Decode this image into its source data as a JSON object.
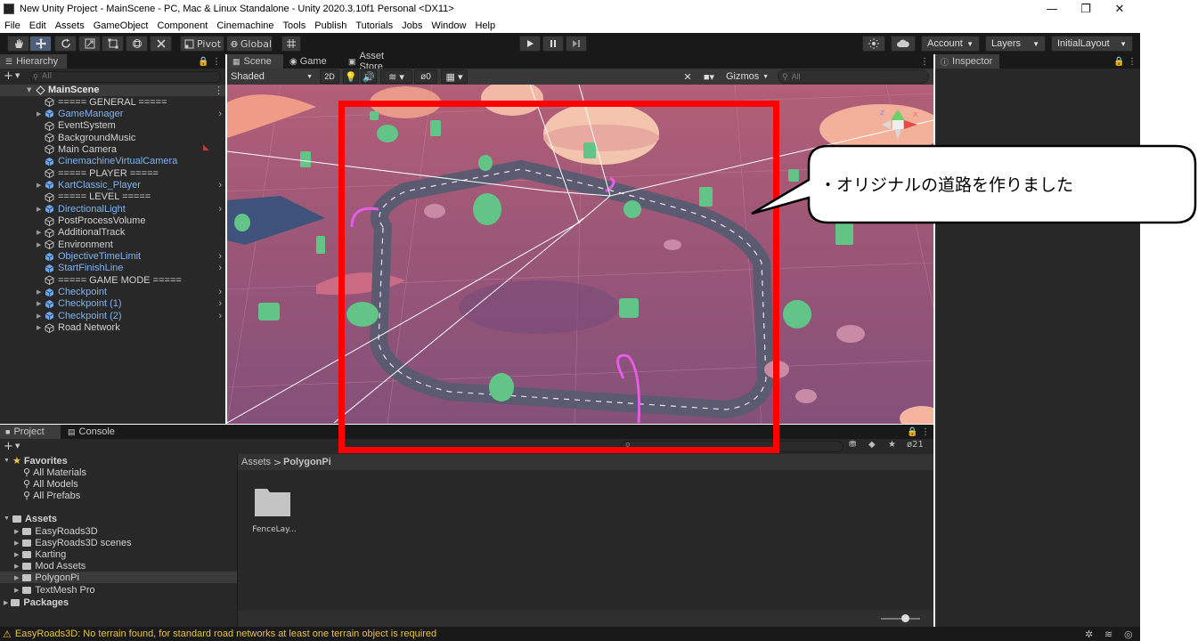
{
  "window": {
    "title": "New Unity Project - MainScene - PC, Mac & Linux Standalone - Unity 2020.3.10f1 Personal <DX11>",
    "controls": [
      "—",
      "❐",
      "✕"
    ]
  },
  "menu": [
    "File",
    "Edit",
    "Assets",
    "GameObject",
    "Component",
    "Cinemachine",
    "Tools",
    "Publish",
    "Tutorials",
    "Jobs",
    "Window",
    "Help"
  ],
  "toolbar": {
    "pivot": "Pivot",
    "global": "Global",
    "account": "Account",
    "layers": "Layers",
    "layout": "InitialLayout"
  },
  "hierarchy": {
    "tab": "Hierarchy",
    "search_placeholder": "All",
    "scene": "MainScene",
    "items": [
      {
        "label": "===== GENERAL =====",
        "blue": false,
        "arrow": false,
        "chev": false
      },
      {
        "label": "GameManager",
        "blue": true,
        "arrow": true,
        "chev": true
      },
      {
        "label": "EventSystem",
        "blue": false,
        "arrow": false,
        "chev": false
      },
      {
        "label": "BackgroundMusic",
        "blue": false,
        "arrow": false,
        "chev": false
      },
      {
        "label": "Main Camera",
        "blue": false,
        "arrow": false,
        "chev": false
      },
      {
        "label": "CinemachineVirtualCamera",
        "blue": true,
        "arrow": false,
        "chev": false
      },
      {
        "label": "===== PLAYER =====",
        "blue": false,
        "arrow": false,
        "chev": false
      },
      {
        "label": "KartClassic_Player",
        "blue": true,
        "arrow": true,
        "chev": true
      },
      {
        "label": "===== LEVEL =====",
        "blue": false,
        "arrow": false,
        "chev": false
      },
      {
        "label": "DirectionalLight",
        "blue": true,
        "arrow": true,
        "chev": true
      },
      {
        "label": "PostProcessVolume",
        "blue": false,
        "arrow": false,
        "chev": false
      },
      {
        "label": "AdditionalTrack",
        "blue": false,
        "arrow": true,
        "chev": false
      },
      {
        "label": "Environment",
        "blue": false,
        "arrow": true,
        "chev": false
      },
      {
        "label": "ObjectiveTimeLimit",
        "blue": true,
        "arrow": false,
        "chev": true
      },
      {
        "label": "StartFinishLine",
        "blue": true,
        "arrow": false,
        "chev": true
      },
      {
        "label": "===== GAME MODE =====",
        "blue": false,
        "arrow": false,
        "chev": false
      },
      {
        "label": "Checkpoint",
        "blue": true,
        "arrow": true,
        "chev": true
      },
      {
        "label": "Checkpoint (1)",
        "blue": true,
        "arrow": true,
        "chev": true
      },
      {
        "label": "Checkpoint (2)",
        "blue": true,
        "arrow": true,
        "chev": true
      },
      {
        "label": "Road Network",
        "blue": false,
        "arrow": true,
        "chev": false
      }
    ]
  },
  "scene_view": {
    "tabs": [
      "Scene",
      "Game",
      "Asset Store"
    ],
    "shading": "Shaded",
    "mode_2d": "2D",
    "hidden_count": "0",
    "gizmos": "Gizmos",
    "search_placeholder": "All",
    "gizmo_axes": {
      "x": "x",
      "z": "z"
    }
  },
  "inspector": {
    "tab": "Inspector"
  },
  "project": {
    "tabs": [
      "Project",
      "Console"
    ],
    "favorites_label": "Favorites",
    "favorites": [
      "All Materials",
      "All Models",
      "All Prefabs"
    ],
    "assets_label": "Assets",
    "assets": [
      "EasyRoads3D",
      "EasyRoads3D scenes",
      "Karting",
      "Mod Assets",
      "PolygonPi",
      "TextMesh Pro"
    ],
    "packages_label": "Packages",
    "breadcrumb": [
      "Assets",
      "PolygonPi"
    ],
    "file_label": "FenceLay...",
    "hidden_count": "21"
  },
  "status": {
    "message": "EasyRoads3D: No terrain found, for standard road networks at least one terrain object is required"
  },
  "annotation": {
    "text": "・オリジナルの道路を作りました",
    "box_color": "#ff0000"
  },
  "colors": {
    "editor_bg": "#282828",
    "blue_text": "#7fb3ee",
    "sky": "#a45a78",
    "road": "#56566e",
    "tree": "#62c587",
    "warning": "#e8c23e"
  }
}
